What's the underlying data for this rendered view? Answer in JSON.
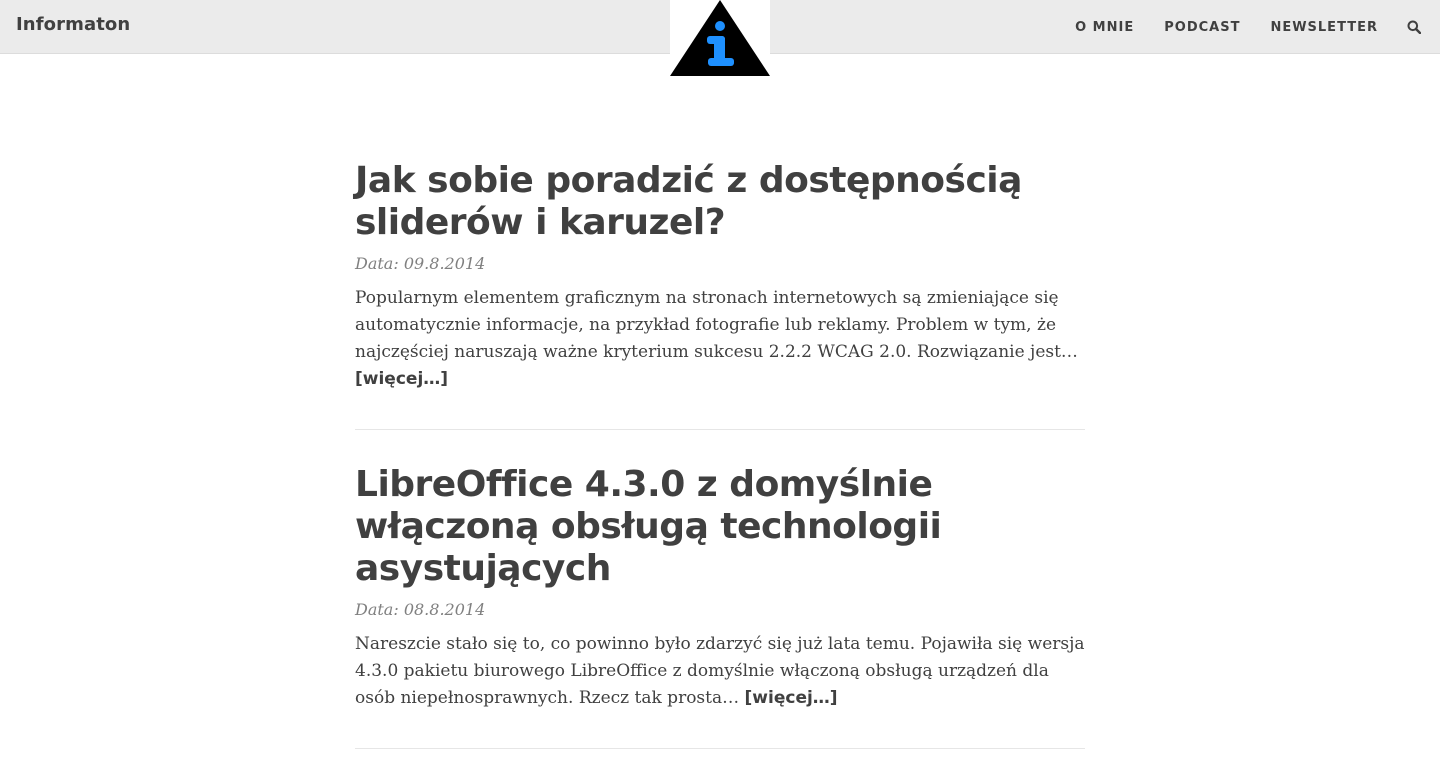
{
  "site": {
    "brand": "Informaton",
    "logo_icon": "info-triangle-logo",
    "logo_colors": {
      "triangle": "#000000",
      "glyph": "#1e90ff"
    }
  },
  "nav": {
    "items": [
      {
        "label": "O MNIE"
      },
      {
        "label": "PODCAST"
      },
      {
        "label": "NEWSLETTER"
      }
    ],
    "search_icon": "search-icon"
  },
  "posts": [
    {
      "title": "Jak sobie poradzić z dostępnością sliderów i karuzel?",
      "date": "Data: 09.8.2014",
      "excerpt": "Popularnym elementem graficznym na stronach internetowych są zmieniające się automatycznie informacje, na przykład fotografie lub reklamy. Problem w tym, że najczęściej naruszają ważne kryterium sukcesu 2.2.2 WCAG 2.0. Rozwiązanie jest…",
      "more": "[więcej…]"
    },
    {
      "title": "LibreOffice 4.3.0 z domyślnie włączoną obsługą technologii asystujących",
      "date": "Data: 08.8.2014",
      "excerpt": "Nareszcie stało się to, co powinno było zdarzyć się już lata temu. Pojawiła się wersja 4.3.0 pakietu biurowego LibreOffice z domyślnie włączoną obsługą urządzeń dla osób niepełnosprawnych. Rzecz tak prosta…",
      "more": "[więcej…]"
    }
  ]
}
